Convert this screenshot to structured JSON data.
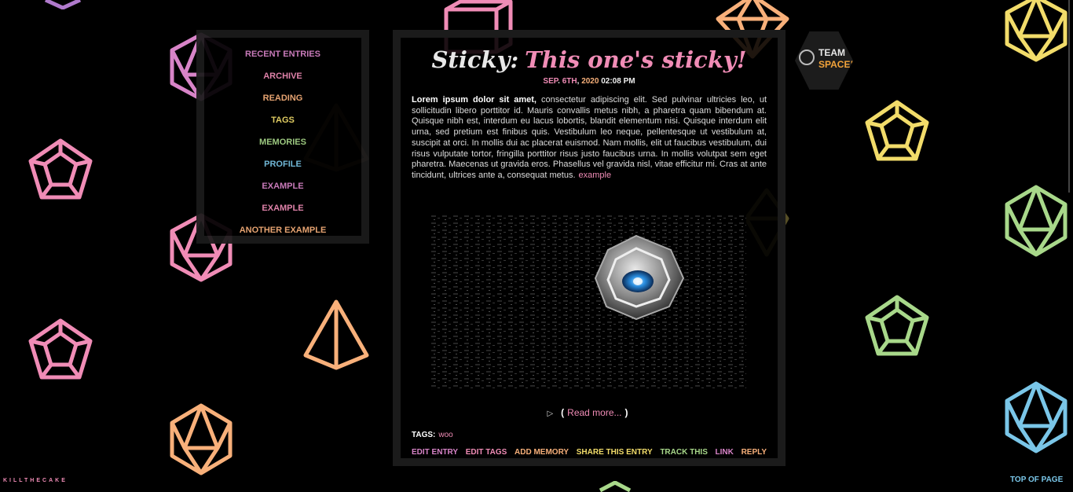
{
  "sidebar": {
    "items": [
      {
        "label": "RECENT ENTRIES",
        "color": "#d884c8"
      },
      {
        "label": "ARCHIVE",
        "color": "#f08cb6"
      },
      {
        "label": "READING",
        "color": "#f8b07a"
      },
      {
        "label": "TAGS",
        "color": "#f2dc6a"
      },
      {
        "label": "MEMORIES",
        "color": "#a8d88a"
      },
      {
        "label": "PROFILE",
        "color": "#7ac6e8"
      },
      {
        "label": "EXAMPLE",
        "color": "#d884c8"
      },
      {
        "label": "EXAMPLE",
        "color": "#f08cb6"
      },
      {
        "label": "ANOTHER EXAMPLE",
        "color": "#f8b07a"
      }
    ]
  },
  "entry": {
    "sticky_label": "Sticky:",
    "subject": "This one's sticky!",
    "date": {
      "month_day_sep": "SEP",
      "dot": ".",
      "day": "6TH",
      "comma": ",",
      "year": "2020",
      "time": "02:08 PM"
    },
    "body_bold": "Lorem ipsum dolor sit amet,",
    "body_text": " consectetur adipiscing elit. Sed pulvinar ultricies leo, ut sollicitudin libero porttitor id. Mauris convallis metus nibh, a pharetra quam bibendum at. Quisque nibh est, interdum eu lacus lobortis, blandit elementum nisi. Quisque interdum elit urna, sed pretium est finibus quis. Vestibulum leo neque, pellentesque ut vestibulum at, suscipit at orci. In mollis dui ac placerat euismod. Nam mollis, elit ut faucibus vestibulum, dui risus vulputate tortor, fringilla porttitor risus justo faucibus urna. In mollis volutpat sem eget pharetra. Maecenas ut gravida eros. Phasellus vel gravida nisl, vitae efficitur mi. Cras at ante tincidunt, ultrices ante a, consequat metus.",
    "body_link": "example",
    "readmore": {
      "open": "(",
      "label": "Read more...",
      "close": ")"
    },
    "tags_label": "TAGS:",
    "tag": "woo",
    "actions": [
      {
        "label": "EDIT ENTRY",
        "color": "#d884c8"
      },
      {
        "label": "EDIT TAGS",
        "color": "#f08cb6"
      },
      {
        "label": "ADD MEMORY",
        "color": "#f8b07a"
      },
      {
        "label": "SHARE THIS ENTRY",
        "color": "#f2dc6a"
      },
      {
        "label": "TRACK THIS",
        "color": "#a8d88a"
      },
      {
        "label": "LINK",
        "color": "#d884c8"
      },
      {
        "label": "REPLY",
        "color": "#f8b07a"
      }
    ]
  },
  "badge": {
    "line1": "TEAM",
    "line2": "SPACE!!"
  },
  "footer": {
    "credit": "KILLTHECAKE",
    "top_link": "TOP OF PAGE"
  },
  "colors": {
    "pink": "#f08cb6",
    "magenta": "#d884c8",
    "orange": "#f8b07a",
    "yellow": "#f2dc6a",
    "green": "#a8d88a",
    "blue": "#7ac6e8"
  }
}
